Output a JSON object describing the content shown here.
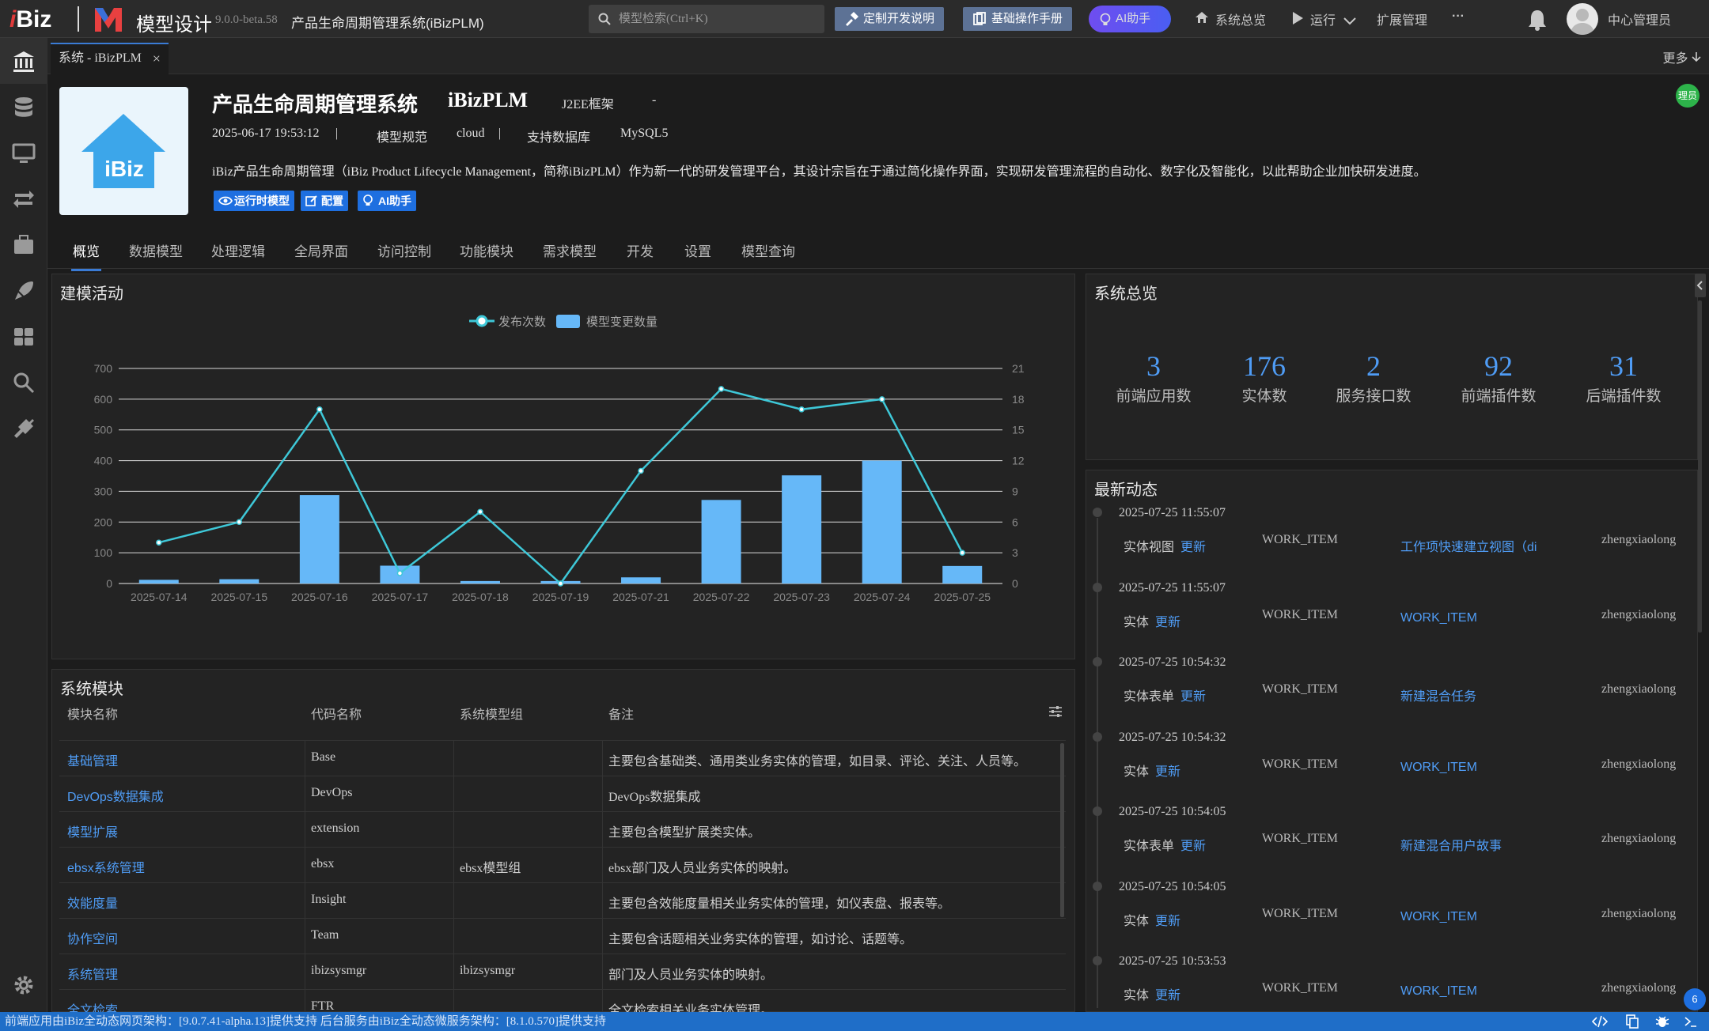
{
  "topbar": {
    "logo_i": "i",
    "logo_biz": "Biz",
    "app_title": "模型设计",
    "version": "9.0.0-beta.58",
    "system_name": "产品生命周期管理系统(iBizPLM)",
    "search_placeholder": "模型检索(Ctrl+K)",
    "btn_custom_dev": "定制开发说明",
    "btn_manual": "基础操作手册",
    "btn_ai": "AI助手",
    "nav_overview": "系统总览",
    "nav_run": "运行",
    "nav_ext": "扩展管理",
    "nav_more": "···",
    "user": "中心管理员"
  },
  "tabs": {
    "current": "系统 - iBizPLM",
    "close": "×",
    "more": "更多"
  },
  "badge": "理员",
  "project": {
    "logo_text": "iBiz",
    "name": "产品生命周期管理系统",
    "code": "iBizPLM",
    "framework": "J2EE框架",
    "dash": "-",
    "date": "2025-06-17 19:53:12",
    "sep": "|",
    "spec_label": "模型规范",
    "spec_value": "cloud",
    "db_label": "支持数据库",
    "db_value": "MySQL5",
    "description": "iBiz产品生命周期管理（iBiz Product Lifecycle Management，简称iBizPLM）作为新一代的研发管理平台，其设计宗旨在于通过简化操作界面，实现研发管理流程的自动化、数字化及智能化，以此帮助企业加快研发进度。",
    "btn_runtime": "运行时模型",
    "btn_config": "配置",
    "btn_ai": "AI助手"
  },
  "subtabs": [
    "概览",
    "数据模型",
    "处理逻辑",
    "全局界面",
    "访问控制",
    "功能模块",
    "需求模型",
    "开发",
    "设置",
    "模型查询"
  ],
  "activity_chart": {
    "title": "建模活动"
  },
  "chart_data": {
    "type": "bar",
    "categories": [
      "2025-07-14",
      "2025-07-15",
      "2025-07-16",
      "2025-07-17",
      "2025-07-18",
      "2025-07-19",
      "2025-07-21",
      "2025-07-22",
      "2025-07-23",
      "2025-07-24",
      "2025-07-25"
    ],
    "series": [
      {
        "name": "模型变更数量",
        "type": "bar",
        "axis": "left",
        "color": "#66b8f8",
        "values": [
          12,
          14,
          288,
          58,
          8,
          8,
          20,
          272,
          352,
          400,
          57
        ]
      },
      {
        "name": "发布次数",
        "type": "line",
        "axis": "right",
        "color": "#3ec8d8",
        "values": [
          4,
          6,
          17,
          1,
          7,
          0,
          11,
          19,
          17,
          18,
          3
        ]
      }
    ],
    "ylim_left": [
      0,
      700
    ],
    "yticks_left": [
      0,
      100,
      200,
      300,
      400,
      500,
      600,
      700
    ],
    "ylim_right": [
      0,
      21
    ],
    "yticks_right": [
      0,
      3,
      6,
      9,
      12,
      15,
      18,
      21
    ],
    "legend_position": "top-center",
    "grid": true
  },
  "overview": {
    "title": "系统总览",
    "stats": [
      {
        "value": "3",
        "label": "前端应用数"
      },
      {
        "value": "176",
        "label": "实体数"
      },
      {
        "value": "2",
        "label": "服务接口数"
      },
      {
        "value": "92",
        "label": "前端插件数"
      },
      {
        "value": "31",
        "label": "后端插件数"
      }
    ]
  },
  "recent": {
    "title": "最新动态",
    "items": [
      {
        "time": "2025-07-25 11:55:07",
        "type": "实体视图",
        "action": "更新",
        "entity": "WORK_ITEM",
        "target": "工作项快速建立视图（di",
        "user": "zhengxiaolong"
      },
      {
        "time": "2025-07-25 11:55:07",
        "type": "实体",
        "action": "更新",
        "entity": "WORK_ITEM",
        "target": "WORK_ITEM",
        "user": "zhengxiaolong"
      },
      {
        "time": "2025-07-25 10:54:32",
        "type": "实体表单",
        "action": "更新",
        "entity": "WORK_ITEM",
        "target": "新建混合任务",
        "user": "zhengxiaolong"
      },
      {
        "time": "2025-07-25 10:54:32",
        "type": "实体",
        "action": "更新",
        "entity": "WORK_ITEM",
        "target": "WORK_ITEM",
        "user": "zhengxiaolong"
      },
      {
        "time": "2025-07-25 10:54:05",
        "type": "实体表单",
        "action": "更新",
        "entity": "WORK_ITEM",
        "target": "新建混合用户故事",
        "user": "zhengxiaolong"
      },
      {
        "time": "2025-07-25 10:54:05",
        "type": "实体",
        "action": "更新",
        "entity": "WORK_ITEM",
        "target": "WORK_ITEM",
        "user": "zhengxiaolong"
      },
      {
        "time": "2025-07-25 10:53:53",
        "type": "实体",
        "action": "更新",
        "entity": "WORK_ITEM",
        "target": "WORK_ITEM",
        "user": "zhengxiaolong"
      }
    ]
  },
  "modules": {
    "title": "系统模块",
    "headers": [
      "模块名称",
      "代码名称",
      "系统模型组",
      "备注"
    ],
    "rows": [
      [
        "基础管理",
        "Base",
        "",
        "主要包含基础类、通用类业务实体的管理，如目录、评论、关注、人员等。"
      ],
      [
        "DevOps数据集成",
        "DevOps",
        "",
        "DevOps数据集成"
      ],
      [
        "模型扩展",
        "extension",
        "",
        "主要包含模型扩展类实体。"
      ],
      [
        "ebsx系统管理",
        "ebsx",
        "ebsx模型组",
        "ebsx部门及人员业务实体的映射。"
      ],
      [
        "效能度量",
        "Insight",
        "",
        "主要包含效能度量相关业务实体的管理，如仪表盘、报表等。"
      ],
      [
        "协作空间",
        "Team",
        "",
        "主要包含话题相关业务实体的管理，如讨论、话题等。"
      ],
      [
        "系统管理",
        "ibizsysmgr",
        "ibizsysmgr",
        "部门及人员业务实体的映射。"
      ],
      [
        "全文检索",
        "FTR",
        "",
        "全文检索相关业务实体管理。"
      ]
    ]
  },
  "footer": {
    "text": "前端应用由iBiz全动态网页架构：[9.0.7.41-alpha.13]提供支持 后台服务由iBiz全动态微服务架构：[8.1.0.570]提供支持"
  },
  "notif_count": "6"
}
